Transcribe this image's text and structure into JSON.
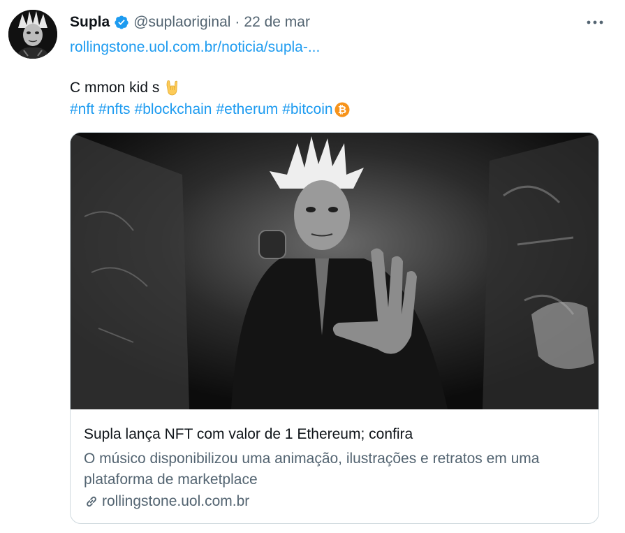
{
  "tweet": {
    "author_name": "Supla",
    "author_handle": "@suplaoriginal",
    "separator": "·",
    "date": "22 de mar",
    "link_text": "rollingstone.uol.com.br/noticia/supla-...",
    "text": "C mmon kid s",
    "hashtags": [
      "#nft",
      "#nfts",
      "#blockchain",
      "#etherum",
      "#bitcoin"
    ]
  },
  "card": {
    "title": "Supla lança NFT com valor de 1 Ethereum; confira",
    "description": "O músico disponibilizou uma animação, ilustrações e retratos em uma plataforma de marketplace",
    "domain": "rollingstone.uol.com.br"
  },
  "icons": {
    "verified": "verified-badge-icon",
    "more": "more-options-icon",
    "hand": "sign-of-horns-emoji",
    "bitcoin": "bitcoin-emoji",
    "link": "link-icon"
  },
  "colors": {
    "accent": "#1d9bf0",
    "secondary_text": "#536471",
    "bitcoin": "#f7931a"
  }
}
